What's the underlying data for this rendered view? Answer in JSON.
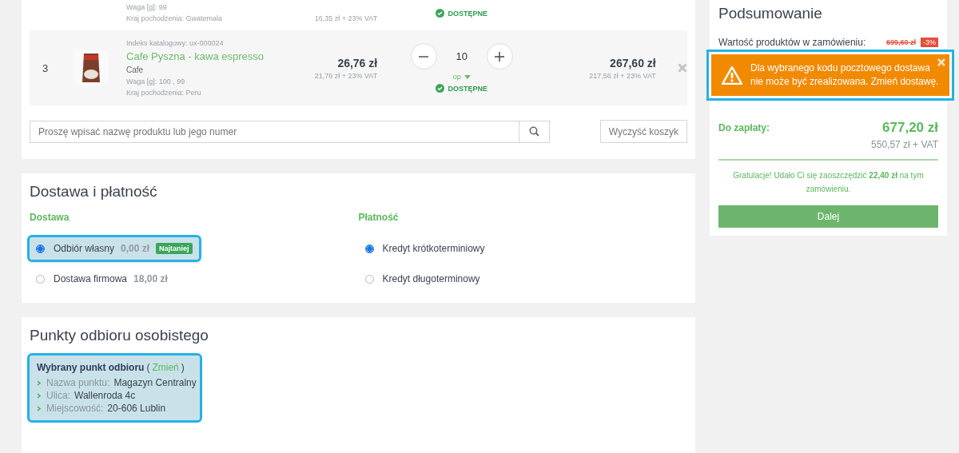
{
  "cart": {
    "rows": [
      {
        "weight": "Waga [g]: 99",
        "origin": "Kraj pochodzenia: Gwatemala",
        "price_net": "16,35 zł + 23% VAT",
        "availability": "DOSTĘPNE"
      },
      {
        "index": "3",
        "catalog": "Indeks katalogowy: ux-000024",
        "name": "Cafe Pyszna - kawa espresso",
        "brand": "Cafe",
        "weight": "Waga [g]: 100  , 99",
        "origin": "Kraj pochodzenia: Peru",
        "price": "26,76 zł",
        "price_net": "21,76 zł + 23% VAT",
        "quantity": "10",
        "unit": "op",
        "availability": "DOSTĘPNE",
        "total": "267,60 zł",
        "total_net": "217,56 zł + 23% VAT"
      }
    ],
    "search": {
      "placeholder": "Proszę wpisać nazwę produktu lub jego numer"
    },
    "clear_button": "Wyczyść koszyk"
  },
  "delivery_payment": {
    "title": "Dostawa i płatność",
    "delivery": {
      "heading": "Dostawa",
      "options": [
        {
          "label": "Odbiór własny",
          "price": "0,00 zł",
          "badge": "Najtaniej",
          "selected": true,
          "highlighted": true
        },
        {
          "label": "Dostawa firmowa",
          "price": "18,00 zł",
          "selected": false,
          "highlighted": false
        }
      ]
    },
    "payment": {
      "heading": "Płatność",
      "options": [
        {
          "label": "Kredyt krótkoterminiowy",
          "selected": true
        },
        {
          "label": "Kredyt długoterminowy",
          "selected": false
        }
      ]
    }
  },
  "pickup": {
    "title": "Punkty odbioru osobistego",
    "highlighted": true,
    "heading": "Wybrany punkt odbioru",
    "link_open": "(",
    "change_link": "Zmień",
    "link_close": ")",
    "fields": [
      {
        "label": "Nazwa punktu:",
        "value": "Magazyn Centralny"
      },
      {
        "label": "Ulica:",
        "value": "Wallenroda 4c"
      },
      {
        "label": "Miejscowość:",
        "value": "20-606 Lublin"
      }
    ]
  },
  "summary": {
    "title": "Podsumowanie",
    "products_label": "Wartość produktów w zamówieniu:",
    "products_old_price": "699,60 zł",
    "discount_badge": "-3%",
    "alert": {
      "text": "Dla wybranego kodu pocztowego dostawa nie może być zrealizowana. Zmień dostawę.",
      "highlighted": true
    },
    "to_pay_label": "Do zapłaty:",
    "to_pay": "677,20 zł",
    "to_pay_net": "550,57 zł + VAT",
    "savings": "Gratulacje! Udało Ci się zaoszczędzić **22,40 zł** na tym zamówieniu.",
    "next_button": "Dalej"
  }
}
